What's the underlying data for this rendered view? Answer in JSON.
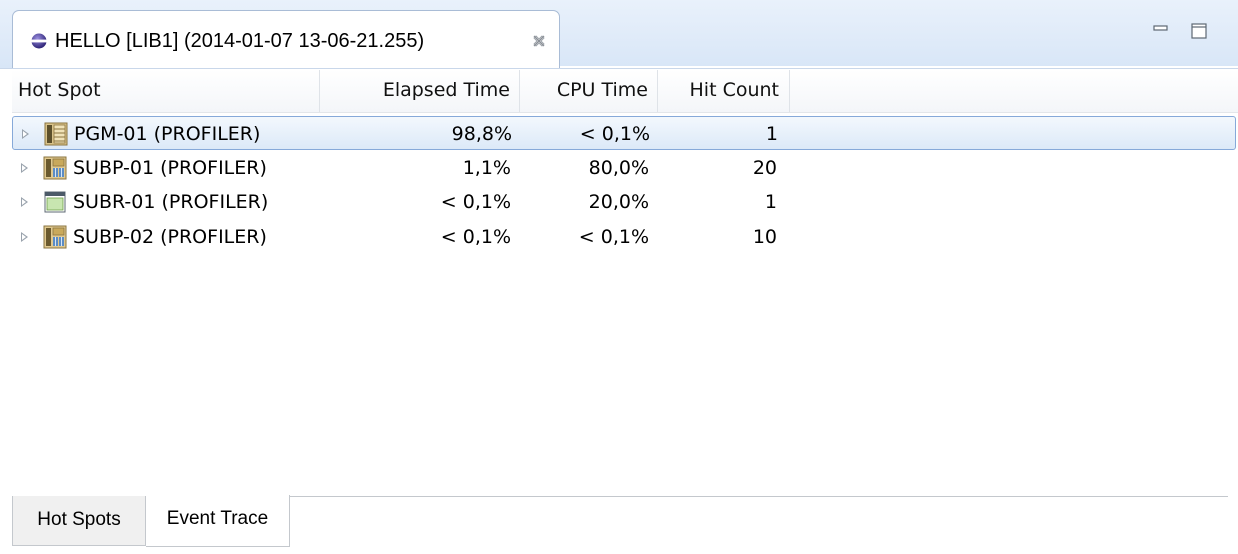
{
  "editor": {
    "tab_title": "HELLO [LIB1] (2014-01-07 13-06-21.255)",
    "tab_icon": "profiler-sphere-icon",
    "close_icon": "close-icon",
    "window_controls": [
      "minimize-icon",
      "maximize-icon"
    ]
  },
  "table": {
    "columns": [
      "Hot Spot",
      "Elapsed Time",
      "CPU Time",
      "Hit Count"
    ],
    "rows": [
      {
        "name": "PGM-01 (PROFILER)",
        "elapsed": "98,8%",
        "cpu": "< 0,1%",
        "hits": "1",
        "icon": "program-icon",
        "selected": true
      },
      {
        "name": "SUBP-01 (PROFILER)",
        "elapsed": "1,1%",
        "cpu": "80,0%",
        "hits": "20",
        "icon": "subprogram-icon",
        "selected": false
      },
      {
        "name": "SUBR-01 (PROFILER)",
        "elapsed": "< 0,1%",
        "cpu": "20,0%",
        "hits": "1",
        "icon": "subroutine-icon",
        "selected": false
      },
      {
        "name": "SUBP-02 (PROFILER)",
        "elapsed": "< 0,1%",
        "cpu": "< 0,1%",
        "hits": "10",
        "icon": "subprogram-icon",
        "selected": false
      }
    ]
  },
  "bottom_tabs": {
    "items": [
      "Hot Spots",
      "Event Trace"
    ],
    "active": "Event Trace"
  },
  "colors": {
    "selection_border": "#86a9d9",
    "tab_strip": "#d8e6f7"
  }
}
